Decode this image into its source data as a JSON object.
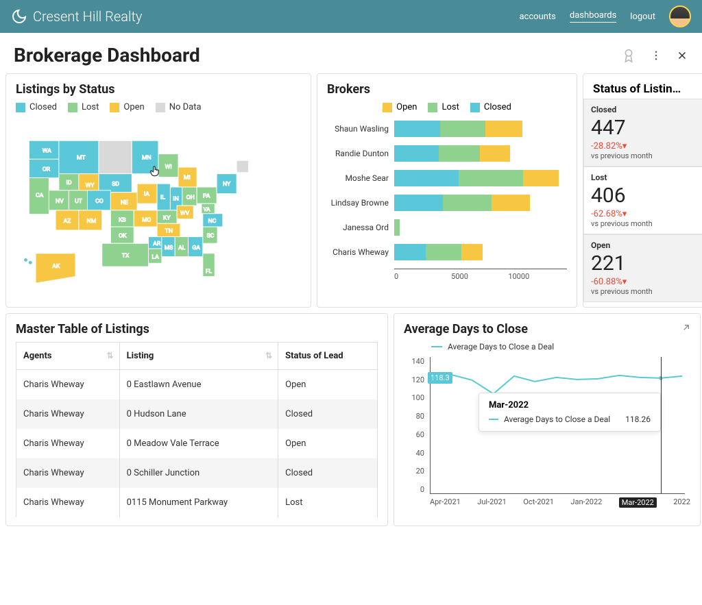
{
  "brand": "Cresent Hill Realty",
  "nav": {
    "accounts": "accounts",
    "dashboards": "dashboards",
    "logout": "logout"
  },
  "page_title": "Brokerage Dashboard",
  "colors": {
    "closed": "#5ac8d8",
    "lost": "#8fd18f",
    "open": "#f7c744",
    "nodata": "#d9d9d9"
  },
  "listings_by_status": {
    "title": "Listings by Status",
    "legend": [
      {
        "label": "Closed",
        "key": "closed"
      },
      {
        "label": "Lost",
        "key": "lost"
      },
      {
        "label": "Open",
        "key": "open"
      },
      {
        "label": "No Data",
        "key": "nodata"
      }
    ]
  },
  "brokers": {
    "title": "Brokers",
    "legend": [
      {
        "label": "Open",
        "key": "open"
      },
      {
        "label": "Lost",
        "key": "lost"
      },
      {
        "label": "Closed",
        "key": "closed"
      }
    ],
    "axis_max": 12000,
    "axis_ticks": [
      "0",
      "5000",
      "10000"
    ],
    "rows": [
      {
        "name": "Shaun Wasling",
        "closed": 3200,
        "lost": 3200,
        "open": 2600
      },
      {
        "name": "Randie Dunton",
        "closed": 3100,
        "lost": 2900,
        "open": 2100
      },
      {
        "name": "Moshe Sear",
        "closed": 4500,
        "lost": 4500,
        "open": 2500
      },
      {
        "name": "Lindsay Browne",
        "closed": 3400,
        "lost": 3400,
        "open": 2700
      },
      {
        "name": "Janessa Ord",
        "closed": 0,
        "lost": 400,
        "open": 0
      },
      {
        "name": "Charis Wheway",
        "closed": 2200,
        "lost": 2500,
        "open": 1500
      }
    ]
  },
  "status_summary": {
    "title": "Status of Listin…",
    "cards": [
      {
        "label": "Closed",
        "value": "447",
        "delta": "-28.82%▾",
        "sub": "vs previous month",
        "sel": true
      },
      {
        "label": "Lost",
        "value": "406",
        "delta": "-62.68%▾",
        "sub": "vs previous month",
        "sel": false
      },
      {
        "label": "Open",
        "value": "221",
        "delta": "-60.88%▾",
        "sub": "vs previous month",
        "sel": true
      }
    ]
  },
  "master_table": {
    "title": "Master Table of Listings",
    "columns": [
      "Agents",
      "Listing",
      "Status of Lead"
    ],
    "rows": [
      [
        "Charis Wheway",
        "0 Eastlawn Avenue",
        "Open"
      ],
      [
        "Charis Wheway",
        "0 Hudson Lane",
        "Closed"
      ],
      [
        "Charis Wheway",
        "0 Meadow Vale Terrace",
        "Open"
      ],
      [
        "Charis Wheway",
        "0 Schiller Junction",
        "Closed"
      ],
      [
        "Charis Wheway",
        "0115 Monument Parkway",
        "Lost"
      ]
    ]
  },
  "avg_days": {
    "title": "Average Days to Close",
    "series_name": "Average Days to Close a Deal",
    "marker_value": "118.3",
    "tooltip": {
      "month": "Mar-2022",
      "label": "Average Days to Close a Deal",
      "value": "118.26"
    },
    "y_ticks": [
      "140",
      "120",
      "100",
      "80",
      "60",
      "40",
      "20",
      "0"
    ],
    "x_ticks": [
      "Apr-2021",
      "Jul-2021",
      "Oct-2021",
      "Jan-2022",
      "Mar-2022",
      "2022"
    ],
    "highlight_x": "Mar-2022"
  },
  "chart_data": [
    {
      "type": "bar",
      "title": "Brokers",
      "orientation": "horizontal-stacked",
      "categories": [
        "Shaun Wasling",
        "Randie Dunton",
        "Moshe Sear",
        "Lindsay Browne",
        "Janessa Ord",
        "Charis Wheway"
      ],
      "series": [
        {
          "name": "Closed",
          "values": [
            3200,
            3100,
            4500,
            3400,
            0,
            2200
          ]
        },
        {
          "name": "Lost",
          "values": [
            3200,
            2900,
            4500,
            3400,
            400,
            2500
          ]
        },
        {
          "name": "Open",
          "values": [
            2600,
            2100,
            2500,
            2700,
            0,
            1500
          ]
        }
      ],
      "xlabel": "",
      "ylabel": "",
      "xlim": [
        0,
        12000
      ]
    },
    {
      "type": "line",
      "title": "Average Days to Close",
      "x": [
        "Apr-2021",
        "May-2021",
        "Jun-2021",
        "Jul-2021",
        "Aug-2021",
        "Sep-2021",
        "Oct-2021",
        "Nov-2021",
        "Dec-2021",
        "Jan-2022",
        "Feb-2022",
        "Mar-2022",
        "Apr-2022"
      ],
      "series": [
        {
          "name": "Average Days to Close a Deal",
          "values": [
            124,
            122,
            116,
            102,
            120,
            115,
            119,
            117,
            118,
            121,
            120,
            118.26,
            120
          ]
        }
      ],
      "ylim": [
        0,
        140
      ],
      "annotations": [
        {
          "x": "Mar-2022",
          "y": 118.26,
          "label": "118.3"
        }
      ]
    }
  ]
}
